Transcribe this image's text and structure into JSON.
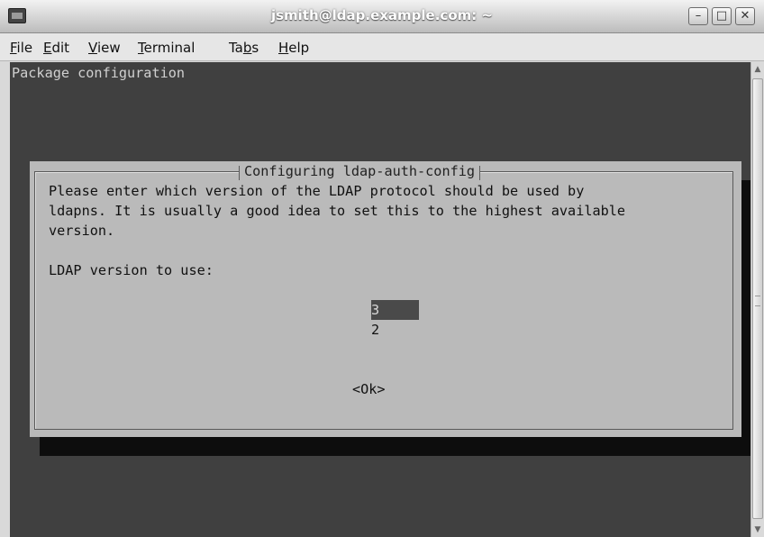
{
  "window": {
    "title": "jsmith@ldap.example.com: ~",
    "controls": {
      "minimize": "–",
      "maximize": "□",
      "close": "✕"
    }
  },
  "menu": [
    {
      "id": "file",
      "mnemonic": "F",
      "rest": "ile"
    },
    {
      "id": "edit",
      "mnemonic": "E",
      "rest": "dit"
    },
    {
      "id": "view",
      "mnemonic": "V",
      "rest": "iew"
    },
    {
      "id": "terminal",
      "mnemonic": "T",
      "rest": "erminal"
    },
    {
      "id": "tabs",
      "pre": "Ta",
      "mnemonic": "b",
      "rest": "s"
    },
    {
      "id": "help",
      "mnemonic": "H",
      "rest": "elp"
    }
  ],
  "terminal": {
    "heading": "Package configuration",
    "dialog": {
      "title": "Configuring ldap-auth-config",
      "text": "Please enter which version of the LDAP protocol should be used by\nldapns. It is usually a good idea to set this to the highest available\nversion.",
      "prompt": "LDAP version to use:",
      "options": [
        "3",
        "2"
      ],
      "selected": "3",
      "ok_button": "<Ok>"
    }
  },
  "icons": {
    "app": "terminal-icon",
    "scroll_up": "arrow-up-icon",
    "scroll_down": "arrow-down-icon"
  }
}
